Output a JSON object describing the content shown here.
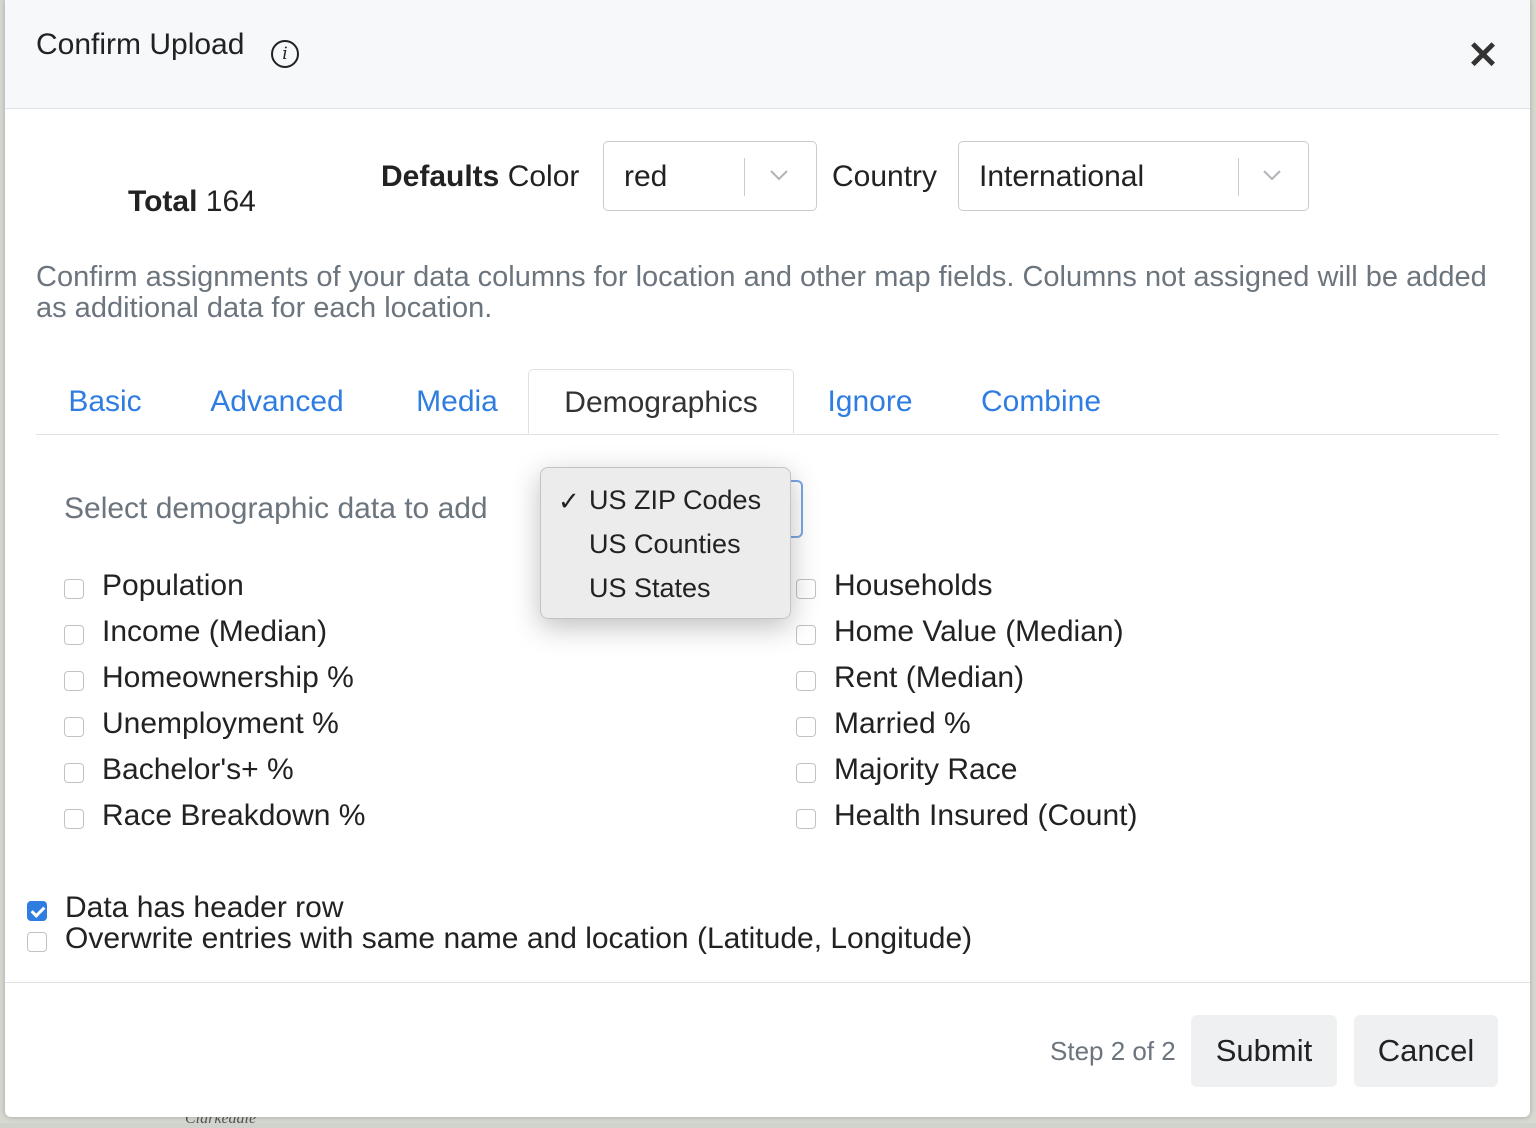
{
  "background": {
    "map_label": "Clarkedale"
  },
  "modal": {
    "title": "Confirm Upload",
    "info_icon": "info-icon",
    "close_icon": "close-icon",
    "close_symbol": "✕"
  },
  "summary": {
    "total_label": "Total",
    "total_value": "164"
  },
  "defaults": {
    "label_bold": "Defaults",
    "color_label": "Color",
    "color_value": "red",
    "country_label": "Country",
    "country_value": "International"
  },
  "description": "Confirm assignments of your data columns for location and other map fields. Columns not assigned will be added as additional data for each location.",
  "tabs": [
    {
      "label": "Basic",
      "active": false
    },
    {
      "label": "Advanced",
      "active": false
    },
    {
      "label": "Media",
      "active": false
    },
    {
      "label": "Demographics",
      "active": true
    },
    {
      "label": "Ignore",
      "active": false
    },
    {
      "label": "Combine",
      "active": false
    }
  ],
  "demographics": {
    "select_label": "Select demographic data to add",
    "dropdown": {
      "options": [
        "US ZIP Codes",
        "US Counties",
        "US States"
      ],
      "selected": "US ZIP Codes",
      "check_symbol": "✓"
    },
    "left_fields": [
      {
        "label": "Population",
        "checked": false
      },
      {
        "label": "Income (Median)",
        "checked": false
      },
      {
        "label": "Homeownership %",
        "checked": false
      },
      {
        "label": "Unemployment %",
        "checked": false
      },
      {
        "label": "Bachelor's+ %",
        "checked": false
      },
      {
        "label": "Race Breakdown %",
        "checked": false
      }
    ],
    "right_fields": [
      {
        "label": "Households",
        "checked": false
      },
      {
        "label": "Home Value (Median)",
        "checked": false
      },
      {
        "label": "Rent (Median)",
        "checked": false
      },
      {
        "label": "Married %",
        "checked": false
      },
      {
        "label": "Majority Race",
        "checked": false
      },
      {
        "label": "Health Insured (Count)",
        "checked": false
      }
    ]
  },
  "options": {
    "header_row": {
      "label": "Data has header row",
      "checked": true
    },
    "overwrite": {
      "label": "Overwrite entries with same name and location (Latitude, Longitude)",
      "checked": false
    }
  },
  "footer": {
    "step": "Step 2 of 2",
    "submit_label": "Submit",
    "cancel_label": "Cancel"
  },
  "colors": {
    "link_blue": "#2f7de1",
    "muted_text": "#6c757d",
    "header_bg": "#f7f8fa",
    "button_bg": "#eef0f2"
  }
}
